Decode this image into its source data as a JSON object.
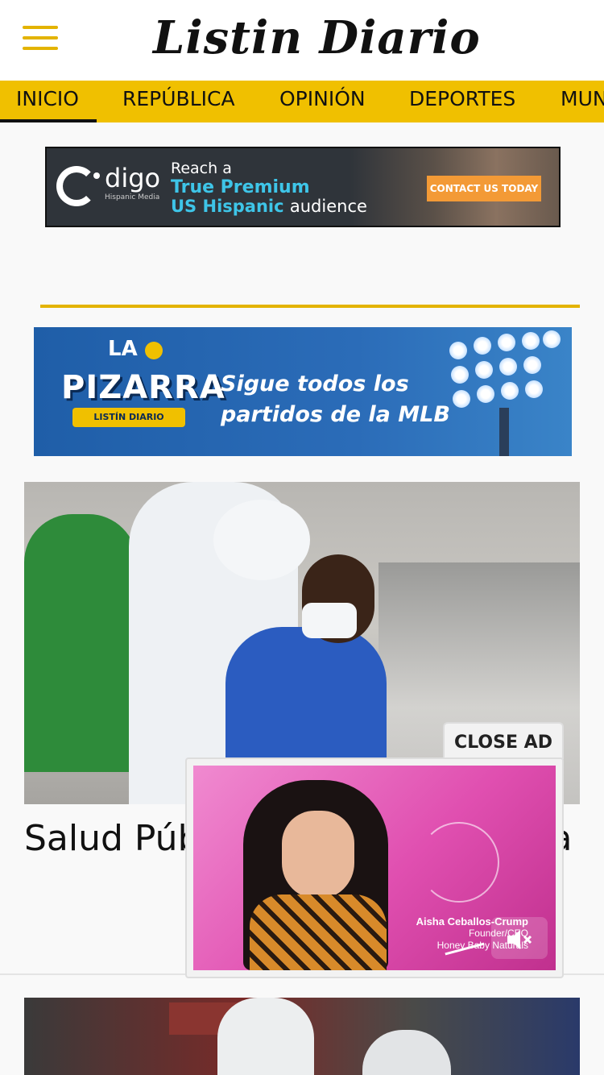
{
  "header": {
    "logo_text": "Listin Diario",
    "menu_icon": "hamburger-menu-icon"
  },
  "nav": {
    "items": [
      {
        "label": "INICIO",
        "active": true
      },
      {
        "label": "REPÚBLICA",
        "active": false
      },
      {
        "label": "OPINIÓN",
        "active": false
      },
      {
        "label": "DEPORTES",
        "active": false
      },
      {
        "label": "MUN",
        "active": false
      }
    ],
    "accent_color": "#f0c000"
  },
  "ad_banner_1": {
    "brand": "digo",
    "brand_sub": "Hispanic Media",
    "line1": "Reach a",
    "line2": "True Premium",
    "line3_highlight": "US Hispanic",
    "line3_rest": "audience",
    "cta": "CONTACT US TODAY"
  },
  "ad_banner_2": {
    "la": "LA",
    "brand": "PIZARRA",
    "ribbon": "LISTÍN DIARIO",
    "slogan": "Sigue todos los partidos de la MLB"
  },
  "story1": {
    "title": "Salud Púb realizan c PCR en La"
  },
  "video_ad": {
    "close_label": "CLOSE AD",
    "caption_name": "Aisha Ceballos-Crump",
    "caption_role": "Founder/CEO",
    "caption_company": "Honey Baby Naturals",
    "mute_icon": "speaker-muted-icon"
  }
}
